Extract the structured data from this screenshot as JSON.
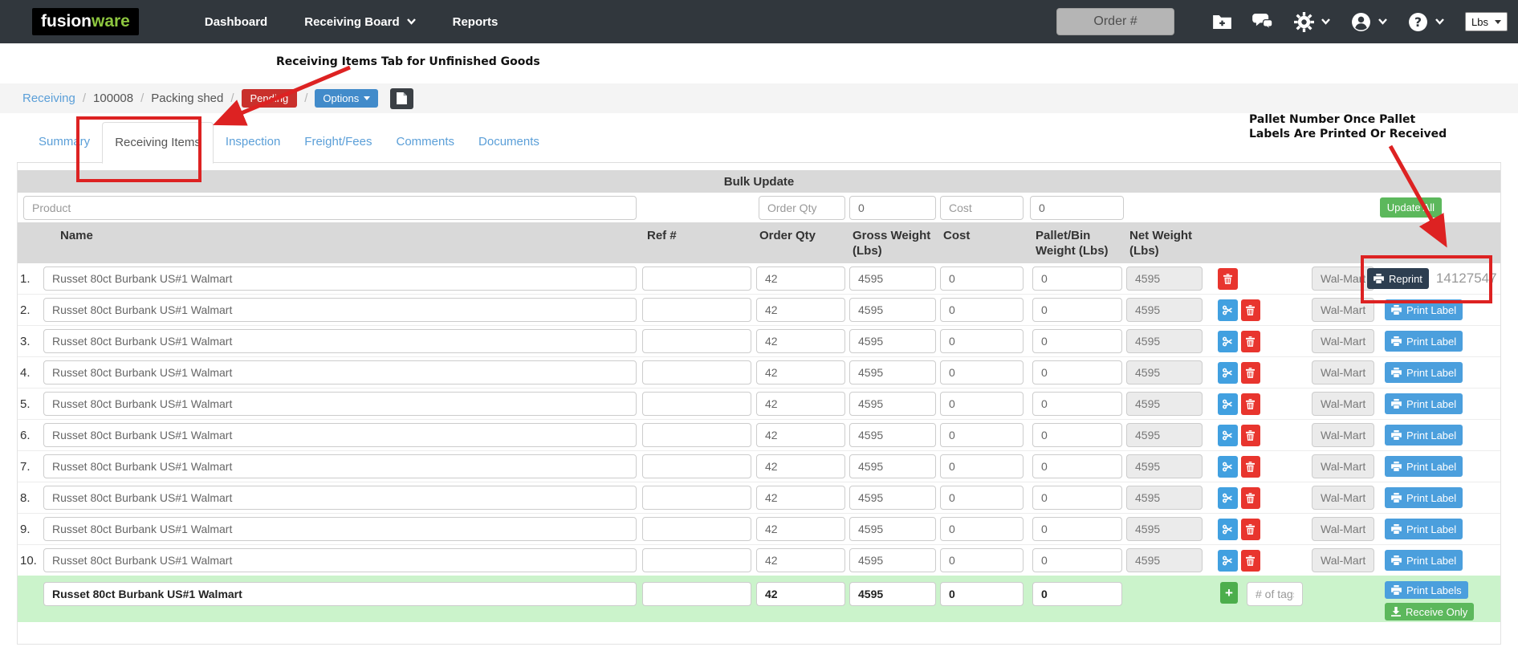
{
  "navbar": {
    "logo_fusion": "fusion",
    "logo_ware": "ware",
    "menu": [
      {
        "label": "Dashboard"
      },
      {
        "label": "Receiving Board"
      },
      {
        "label": "Reports"
      }
    ],
    "order_placeholder": "Order #",
    "unit_label": "Lbs"
  },
  "icons": {
    "add-folder-icon": "folder with plus",
    "messages-icon": "two speech bubbles",
    "settings-icon": "gear",
    "account-icon": "person in circle",
    "help-icon": "question mark in circle",
    "caret-down-icon": "▾",
    "document-icon": "file page",
    "printer-icon": "printer",
    "scissors-icon": "scissors / split",
    "trash-icon": "trash can",
    "add-icon": "+",
    "download-icon": "download arrow"
  },
  "breadcrumb": {
    "link": "Receiving",
    "separator": "/",
    "order_number": "100008",
    "location": "Packing shed",
    "status": "Pending",
    "options_label": "Options"
  },
  "tabs": [
    {
      "label": "Summary",
      "active": false
    },
    {
      "label": "Receiving Items",
      "active": true
    },
    {
      "label": "Inspection",
      "active": false
    },
    {
      "label": "Freight/Fees",
      "active": false
    },
    {
      "label": "Comments",
      "active": false
    },
    {
      "label": "Documents",
      "active": false
    }
  ],
  "annotations": {
    "tab_note": "Receiving Items Tab for Unfinished Goods",
    "pallet_note_line1": "Pallet Number Once Pallet",
    "pallet_note_line2": "Labels Are Printed Or Received",
    "highlight_color": "#dd2222"
  },
  "bulk_update": {
    "title": "Bulk Update",
    "product_placeholder": "Product",
    "order_qty_placeholder": "Order Qty",
    "order_qty_value": "0",
    "cost_placeholder": "Cost",
    "cost_value": "0",
    "update_all_label": "Update All"
  },
  "table": {
    "headers": {
      "name": "Name",
      "ref": "Ref #",
      "order_qty": "Order Qty",
      "gross": "Gross Weight (Lbs)",
      "cost": "Cost",
      "pallet_bin": "Pallet/Bin Weight (Lbs)",
      "net": "Net Weight (Lbs)"
    },
    "reprint_label": "Reprint",
    "print_label": "Print Label",
    "rows": [
      {
        "num": "1.",
        "name": "Russet 80ct Burbank US#1 Walmart",
        "ref": "",
        "order_qty": "42",
        "gross": "4595",
        "cost": "0",
        "pallet_bin": "0",
        "net": "4595",
        "vendor": "Wal-Mart",
        "pallet_number": "14127547"
      },
      {
        "num": "2.",
        "name": "Russet 80ct Burbank US#1 Walmart",
        "ref": "",
        "order_qty": "42",
        "gross": "4595",
        "cost": "0",
        "pallet_bin": "0",
        "net": "4595",
        "vendor": "Wal-Mart",
        "pallet_number": null
      },
      {
        "num": "3.",
        "name": "Russet 80ct Burbank US#1 Walmart",
        "ref": "",
        "order_qty": "42",
        "gross": "4595",
        "cost": "0",
        "pallet_bin": "0",
        "net": "4595",
        "vendor": "Wal-Mart",
        "pallet_number": null
      },
      {
        "num": "4.",
        "name": "Russet 80ct Burbank US#1 Walmart",
        "ref": "",
        "order_qty": "42",
        "gross": "4595",
        "cost": "0",
        "pallet_bin": "0",
        "net": "4595",
        "vendor": "Wal-Mart",
        "pallet_number": null
      },
      {
        "num": "5.",
        "name": "Russet 80ct Burbank US#1 Walmart",
        "ref": "",
        "order_qty": "42",
        "gross": "4595",
        "cost": "0",
        "pallet_bin": "0",
        "net": "4595",
        "vendor": "Wal-Mart",
        "pallet_number": null
      },
      {
        "num": "6.",
        "name": "Russet 80ct Burbank US#1 Walmart",
        "ref": "",
        "order_qty": "42",
        "gross": "4595",
        "cost": "0",
        "pallet_bin": "0",
        "net": "4595",
        "vendor": "Wal-Mart",
        "pallet_number": null
      },
      {
        "num": "7.",
        "name": "Russet 80ct Burbank US#1 Walmart",
        "ref": "",
        "order_qty": "42",
        "gross": "4595",
        "cost": "0",
        "pallet_bin": "0",
        "net": "4595",
        "vendor": "Wal-Mart",
        "pallet_number": null
      },
      {
        "num": "8.",
        "name": "Russet 80ct Burbank US#1 Walmart",
        "ref": "",
        "order_qty": "42",
        "gross": "4595",
        "cost": "0",
        "pallet_bin": "0",
        "net": "4595",
        "vendor": "Wal-Mart",
        "pallet_number": null
      },
      {
        "num": "9.",
        "name": "Russet 80ct Burbank US#1 Walmart",
        "ref": "",
        "order_qty": "42",
        "gross": "4595",
        "cost": "0",
        "pallet_bin": "0",
        "net": "4595",
        "vendor": "Wal-Mart",
        "pallet_number": null
      },
      {
        "num": "10.",
        "name": "Russet 80ct Burbank US#1 Walmart",
        "ref": "",
        "order_qty": "42",
        "gross": "4595",
        "cost": "0",
        "pallet_bin": "0",
        "net": "4595",
        "vendor": "Wal-Mart",
        "pallet_number": null
      }
    ]
  },
  "new_item_row": {
    "name": "Russet 80ct Burbank US#1 Walmart",
    "ref": "",
    "order_qty": "42",
    "gross": "4595",
    "cost": "0",
    "pallet_bin": "0",
    "add_label": "+",
    "tags_placeholder": "# of tags",
    "print_labels_label": "Print Labels",
    "receive_only_label": "Receive Only"
  },
  "colors": {
    "navbar_bg": "#31373d",
    "logo_green": "#8dc63f",
    "link_blue": "#5b9fd8",
    "badge_red": "#c9302c",
    "options_blue": "#428bca",
    "button_blue": "#4b9fdd",
    "danger_red": "#e8352e",
    "success_green": "#5cb85c",
    "reprint_navy": "#2d3e50",
    "row_highlight_green": "#cbf3cb",
    "annotation_red": "#dd2222"
  }
}
